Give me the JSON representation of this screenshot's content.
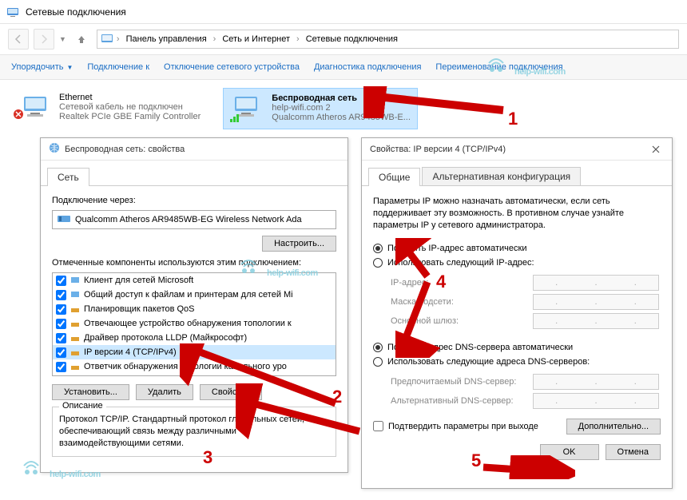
{
  "window": {
    "title": "Сетевые подключения"
  },
  "breadcrumb": {
    "root": "Панель управления",
    "l2": "Сеть и Интернет",
    "l3": "Сетевые подключения"
  },
  "toolbar": {
    "organize": "Упорядочить",
    "connect": "Подключение к",
    "disable": "Отключение сетевого устройства",
    "diag": "Диагностика подключения",
    "rename": "Переименование подключения"
  },
  "connections": {
    "eth": {
      "name": "Ethernet",
      "status": "Сетевой кабель не подключен",
      "adapter": "Realtek PCIe GBE Family Controller"
    },
    "wifi": {
      "name": "Беспроводная сеть",
      "status": "help-wifi.com  2",
      "adapter": "Qualcomm Atheros AR9485WB-E..."
    }
  },
  "dlg1": {
    "title": "Беспроводная сеть: свойства",
    "tab": "Сеть",
    "conn_via": "Подключение через:",
    "adapter": "Qualcomm Atheros AR9485WB-EG Wireless Network Ada",
    "configure": "Настроить...",
    "components_label": "Отмеченные компоненты используются этим подключением:",
    "components": [
      "Клиент для сетей Microsoft",
      "Общий доступ к файлам и принтерам для сетей Mi",
      "Планировщик пакетов QoS",
      "Отвечающее устройство обнаружения топологии к",
      "Драйвер протокола LLDP (Майкрософт)",
      "IP версии 4 (TCP/IPv4)",
      "Ответчик обнаружения топологии канального уро"
    ],
    "install": "Установить...",
    "remove": "Удалить",
    "props": "Свойства",
    "desc_title": "Описание",
    "desc": "Протокол TCP/IP. Стандартный протокол глобальных сетей, обеспечивающий связь между различными взаимодействующими сетями."
  },
  "dlg2": {
    "title": "Свойства: IP версии 4 (TCP/IPv4)",
    "tab_general": "Общие",
    "tab_alt": "Альтернативная конфигурация",
    "explain": "Параметры IP можно назначать автоматически, если сеть поддерживает эту возможность. В противном случае узнайте параметры IP у сетевого администратора.",
    "r_ip_auto": "Получить IP-адрес автоматически",
    "r_ip_manual": "Использовать следующий IP-адрес:",
    "ip_addr": "IP-адрес:",
    "mask": "Маска подсети:",
    "gateway": "Основной шлюз:",
    "r_dns_auto": "Получить адрес DNS-сервера автоматически",
    "r_dns_manual": "Использовать следующие адреса DNS-серверов:",
    "dns_pref": "Предпочитаемый DNS-сервер:",
    "dns_alt": "Альтернативный DNS-сервер:",
    "validate": "Подтвердить параметры при выходе",
    "advanced": "Дополнительно...",
    "ok": "OK",
    "cancel": "Отмена"
  },
  "annotations": {
    "n1": "1",
    "n2": "2",
    "n3": "3",
    "n4": "4",
    "n5": "5"
  },
  "watermark": "help-wifi.com"
}
